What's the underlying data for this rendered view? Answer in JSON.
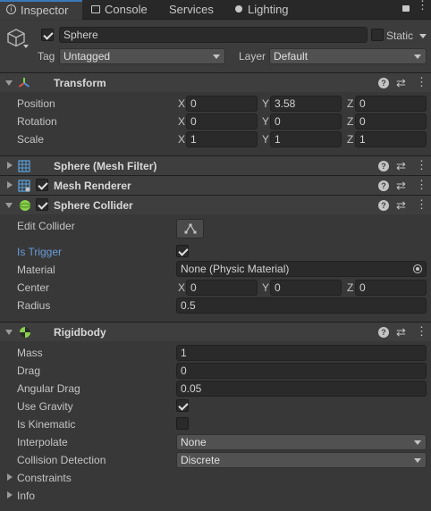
{
  "tabs": [
    {
      "label": "Inspector",
      "icon": "info-icon",
      "active": true
    },
    {
      "label": "Console",
      "icon": "console-icon"
    },
    {
      "label": "Services",
      "icon": "cloud-icon"
    },
    {
      "label": "Lighting",
      "icon": "bulb-icon"
    }
  ],
  "object": {
    "name": "Sphere",
    "active": true,
    "static_label": "Static",
    "tag_label": "Tag",
    "tag_value": "Untagged",
    "layer_label": "Layer",
    "layer_value": "Default"
  },
  "transform": {
    "title": "Transform",
    "position": {
      "label": "Position",
      "x": "0",
      "y": "3.58",
      "z": "0"
    },
    "rotation": {
      "label": "Rotation",
      "x": "0",
      "y": "0",
      "z": "0"
    },
    "scale": {
      "label": "Scale",
      "x": "1",
      "y": "1",
      "z": "1"
    }
  },
  "axes": {
    "x": "X",
    "y": "Y",
    "z": "Z"
  },
  "mesh_filter": {
    "title": "Sphere (Mesh Filter)"
  },
  "mesh_renderer": {
    "title": "Mesh Renderer",
    "enabled": true
  },
  "sphere_collider": {
    "title": "Sphere Collider",
    "enabled": true,
    "edit_collider_label": "Edit Collider",
    "is_trigger_label": "Is Trigger",
    "is_trigger": true,
    "material_label": "Material",
    "material_value": "None (Physic Material)",
    "center_label": "Center",
    "center": {
      "x": "0",
      "y": "0",
      "z": "0"
    },
    "radius_label": "Radius",
    "radius_value": "0.5"
  },
  "rigidbody": {
    "title": "Rigidbody",
    "mass_label": "Mass",
    "mass_value": "1",
    "drag_label": "Drag",
    "drag_value": "0",
    "angular_drag_label": "Angular Drag",
    "angular_drag_value": "0.05",
    "use_gravity_label": "Use Gravity",
    "use_gravity": true,
    "is_kinematic_label": "Is Kinematic",
    "is_kinematic": false,
    "interpolate_label": "Interpolate",
    "interpolate_value": "None",
    "collision_detection_label": "Collision Detection",
    "collision_detection_value": "Discrete",
    "constraints_label": "Constraints",
    "info_label": "Info"
  },
  "colors": {
    "accent": "#3a79bb",
    "trigger_label": "#6a9bd8",
    "background": "#383838"
  }
}
